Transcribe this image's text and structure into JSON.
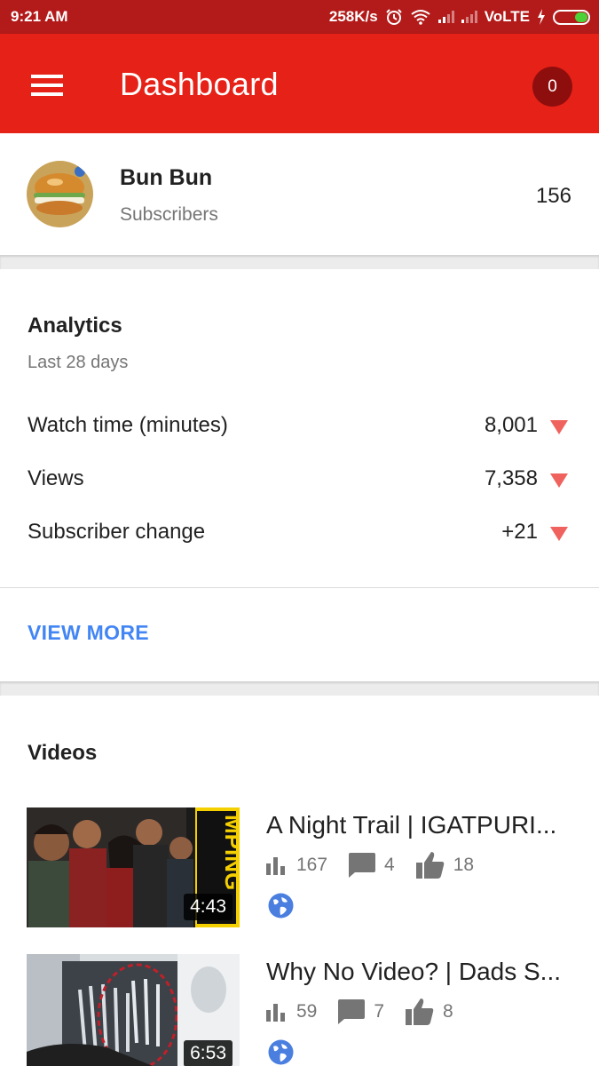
{
  "status_bar": {
    "time": "9:21 AM",
    "speed": "258K/s",
    "network": "VoLTE",
    "icons": [
      "alarm-icon",
      "wifi-icon",
      "signal-icon",
      "charging-icon",
      "battery-icon"
    ]
  },
  "app_bar": {
    "title": "Dashboard",
    "notification_count": "0",
    "menu_icon": "hamburger-menu-icon",
    "bar_color": "#e62117"
  },
  "channel": {
    "name": "Bun Bun",
    "subscribers_label": "Subscribers",
    "subscribers_count": "156"
  },
  "analytics": {
    "title": "Analytics",
    "period": "Last 28 days",
    "metrics": [
      {
        "label": "Watch time (minutes)",
        "value": "8,001",
        "trend": "down"
      },
      {
        "label": "Views",
        "value": "7,358",
        "trend": "down"
      },
      {
        "label": "Subscriber change",
        "value": "+21",
        "trend": "down"
      }
    ],
    "view_more": "VIEW MORE",
    "link_color": "#4285f4",
    "trend_down_color": "#f0625d"
  },
  "videos": {
    "title": "Videos",
    "items": [
      {
        "title": "A Night Trail | IGATPURI...",
        "duration": "4:43",
        "views": "167",
        "comments": "4",
        "likes": "18",
        "visibility": "public-globe-icon",
        "thumb_text": "MPING"
      },
      {
        "title": "Why No Video? | Dads S...",
        "duration": "6:53",
        "views": "59",
        "comments": "7",
        "likes": "8",
        "visibility": "public-globe-icon"
      }
    ]
  }
}
